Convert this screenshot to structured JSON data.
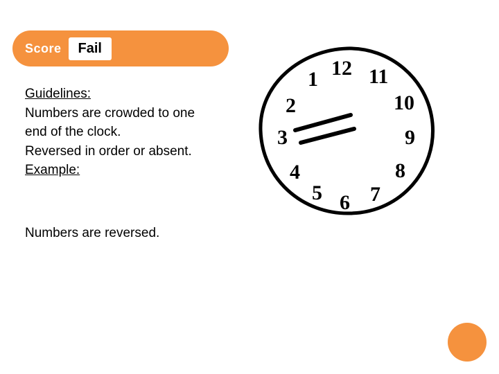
{
  "colors": {
    "accent": "#f5923e"
  },
  "score": {
    "label": "Score",
    "value": "Fail"
  },
  "guidelines": {
    "heading": "Guidelines:",
    "line1": "Numbers are crowded to one end of the clock.",
    "line2": "Reversed in order or absent.",
    "example_heading": "Example:"
  },
  "note": "Numbers are reversed.",
  "clock": {
    "numbers": [
      "12",
      "11",
      "10",
      "9",
      "8",
      "7",
      "6",
      "5",
      "4",
      "3",
      "2",
      "1"
    ],
    "description": "hand-drawn clock with reversed number order"
  }
}
